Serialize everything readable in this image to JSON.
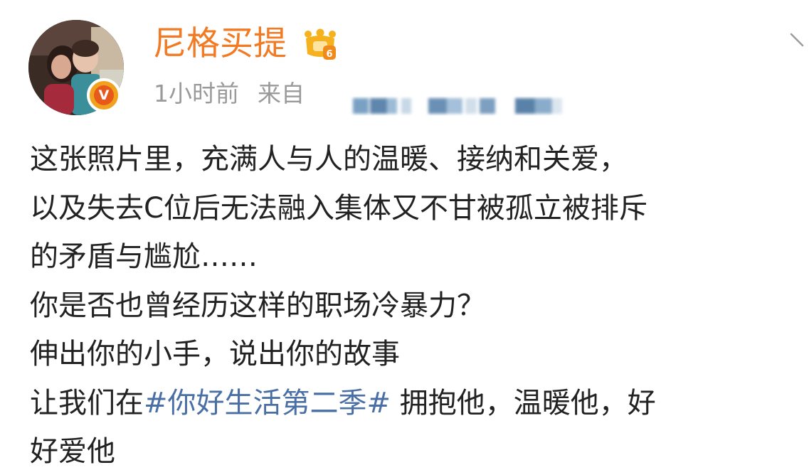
{
  "post": {
    "author": {
      "name": "尼格买提",
      "avatar_icon": "avatar-photo",
      "verified_icon": "verified-badge-icon",
      "member_icon": "crown-icon",
      "colors": {
        "name": "#f17a22",
        "verified": "#f0a11e"
      }
    },
    "meta": {
      "time": "1小时前",
      "source_label": "来自"
    },
    "content": {
      "lines": [
        "这张照片里，充满人与人的温暖、接纳和关爱，",
        "以及失去C位后无法融入集体又不甘被孤立被排斥",
        "的矛盾与尴尬……",
        "你是否也曾经历这样的职场冷暴力？",
        "伸出你的小手，说出你的故事"
      ],
      "line6_prefix": "让我们在",
      "hashtag": "#你好生活第二季#",
      "line6_suffix": "拥抱他，温暖他，好",
      "line7": "好爱他",
      "colors": {
        "text": "#222222",
        "hashtag": "#4a6fa5"
      }
    }
  }
}
